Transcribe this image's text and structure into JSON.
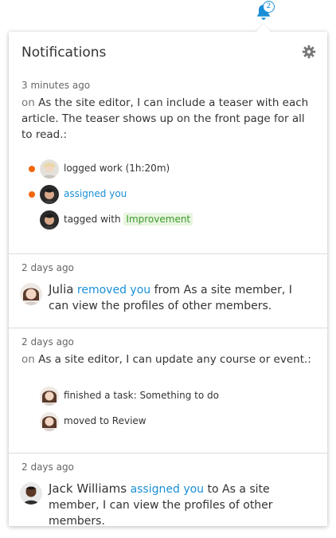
{
  "bell": {
    "count": "2"
  },
  "panel": {
    "title": "Notifications"
  },
  "groups": [
    {
      "time": "3 minutes ago",
      "context_prefix": "on",
      "context_text": "As the site editor, I can include a teaser with each article. The teaser shows up on the front page for all to read.:",
      "items": [
        {
          "text": "logged work (1h:20m)",
          "unread": true
        },
        {
          "link": "assigned you",
          "unread": true
        },
        {
          "text": "tagged with",
          "tag": "Improvement",
          "unread": false
        }
      ]
    },
    {
      "time": "2 days ago",
      "actor": "Julia",
      "link": "removed you",
      "text": "from As a site member, I can view the profiles of other members."
    },
    {
      "time": "2 days ago",
      "context_prefix": "on",
      "context_text": "As a site editor, I can update any course or event.:",
      "items": [
        {
          "text": "finished a task: Something to do"
        },
        {
          "text": "moved to Review"
        }
      ]
    },
    {
      "time": "2 days ago",
      "actor": "Jack Williams",
      "link": "assigned you",
      "text": "to As a site member, I can view the profiles of other members."
    }
  ],
  "colors": {
    "link": "#1a8fd6",
    "unread_dot": "#f0670a",
    "tag_bg": "#e8f5e0",
    "tag_text": "#3d9b2b"
  }
}
